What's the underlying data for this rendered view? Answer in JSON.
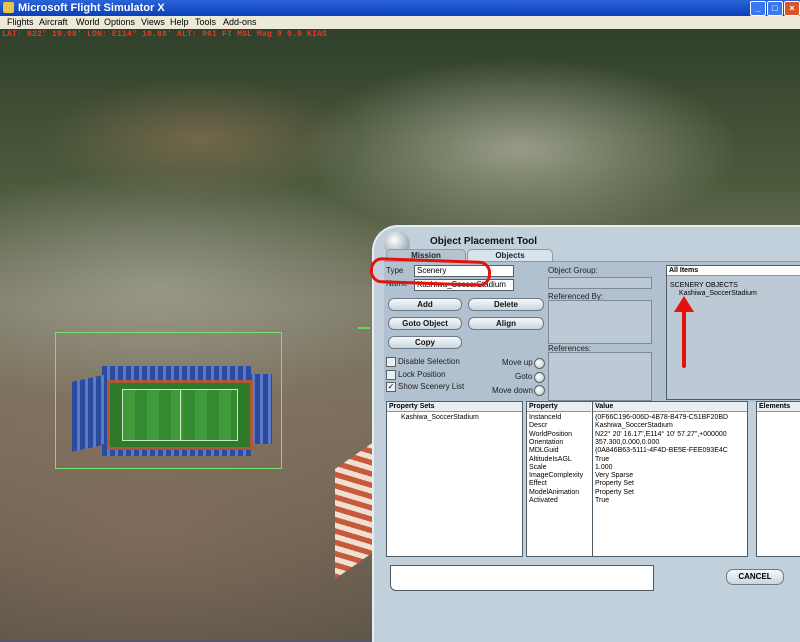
{
  "window": {
    "title": "Microsoft Flight Simulator X",
    "colors": {
      "titlebar": "#0a3fb8",
      "dialog": "#c2d0dc",
      "annotation": "#e3120c"
    }
  },
  "menu": [
    "Flights",
    "Aircraft",
    "World",
    "Options",
    "Views",
    "Help",
    "Tools",
    "Add-ons"
  ],
  "hud": {
    "text": "LAT: N22° 19.08' LON: E114° 10.88' ALT: 961 FT MSL Mag 9 0.0 KIAS"
  },
  "dialog": {
    "title": "Object Placement Tool",
    "tabs": [
      "Mission",
      "Objects"
    ],
    "type_label": "Type",
    "type_value": "Scenery",
    "name_label": "Name",
    "name_value": "Kashiwa_SoccerStadium",
    "object_group_label": "Object Group:",
    "referenced_by_label": "Referenced By:",
    "references_label": "References:",
    "buttons": {
      "add": "Add",
      "delete": "Delete",
      "goto_object": "Goto Object",
      "align": "Align",
      "copy": "Copy",
      "cancel": "CANCEL"
    },
    "checkboxes": [
      {
        "label": "Disable Selection",
        "checked": false
      },
      {
        "label": "Lock Position",
        "checked": false
      },
      {
        "label": "Show Scenery List",
        "checked": true
      }
    ],
    "movers": [
      "Move up",
      "Goto",
      "Move down"
    ],
    "all_items_label": "All Items",
    "tree": {
      "group": "SCENERY OBJECTS",
      "item": "Kashiwa_SoccerStadium"
    },
    "property_sets": {
      "header": "Property Sets",
      "items": [
        "Kashiwa_SoccerStadium"
      ]
    },
    "property_table": {
      "headers": [
        "Property",
        "Value"
      ],
      "rows": [
        [
          "InstanceId",
          "{0F66C196-006D-4B78-B479-C51BF20BD"
        ],
        [
          "Descr",
          "Kashiwa_SoccerStadium"
        ],
        [
          "WorldPosition",
          "N22° 20' 16.17\",E114° 10' 57.27\",+000000"
        ],
        [
          "Orientation",
          "357.300,0.000,0.000"
        ],
        [
          "MDLGuid",
          "{0A846B63-5111-4F4D-BE5E-FEE093E4C"
        ],
        [
          "AltitudeIsAGL",
          "True"
        ],
        [
          "Scale",
          "1.000"
        ],
        [
          "ImageComplexity",
          "Very Sparse"
        ],
        [
          "Effect",
          "Property Set"
        ],
        [
          "ModelAnimation",
          "Property Set"
        ],
        [
          "Activated",
          "True"
        ]
      ]
    },
    "elements_header": "Elements"
  }
}
